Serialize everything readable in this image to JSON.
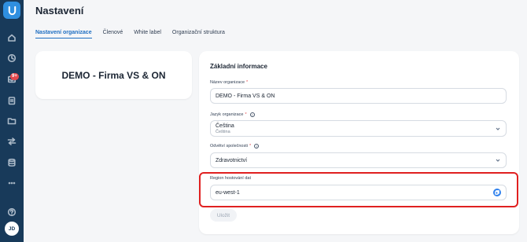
{
  "sidebar": {
    "logo_icon": "brand-logo-icon",
    "items": [
      {
        "icon": "home-icon"
      },
      {
        "icon": "clock-icon"
      },
      {
        "icon": "inbox-icon",
        "badge": "9+"
      },
      {
        "icon": "clipboard-icon"
      },
      {
        "icon": "folder-icon"
      },
      {
        "icon": "transfer-icon"
      },
      {
        "icon": "database-icon"
      },
      {
        "icon": "more-icon"
      },
      {
        "icon": "help-icon"
      }
    ],
    "avatar_initials": "JD"
  },
  "header": {
    "title": "Nastavení"
  },
  "tabs": [
    {
      "label": "Nastavení organizace",
      "active": true
    },
    {
      "label": "Členové",
      "active": false
    },
    {
      "label": "White label",
      "active": false
    },
    {
      "label": "Organizační struktura",
      "active": false
    }
  ],
  "org_card": {
    "name": "DEMO - Firma VS & ON"
  },
  "basic_info": {
    "title": "Základní informace",
    "org_name_label": "Název organizace",
    "org_name_value": "DEMO - Firma VS & ON",
    "language_label": "Jazyk organizace",
    "language_value": "Čeština",
    "language_sub": "Čeština",
    "industry_label": "Odvětví společnosti",
    "industry_value": "Zdravotnictví",
    "region_label": "Region hostování dat",
    "region_value": "eu-west-1",
    "required_mark": "*",
    "save_label": "Uložit"
  },
  "colors": {
    "sidebar_bg": "#183a5a",
    "accent": "#1f6fc2",
    "highlight": "#e02020",
    "badge": "#e5484d"
  }
}
